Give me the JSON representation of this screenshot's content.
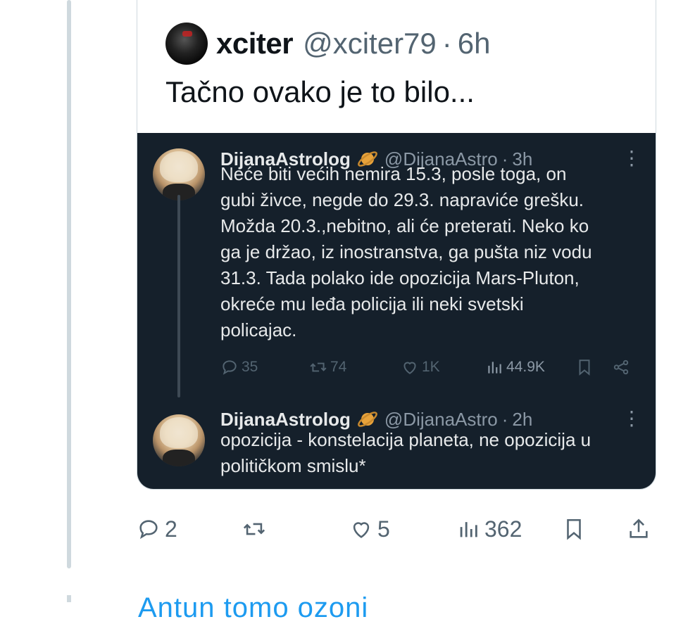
{
  "quote": {
    "author_name": "xciter",
    "author_handle": "@xciter79",
    "separator": "·",
    "time": "6h",
    "text": "Tačno ovako je to bilo..."
  },
  "embedded": {
    "tweet1": {
      "name": "DijanaAstrolog",
      "handle": "@DijanaAstro",
      "separator": "·",
      "time": "3h",
      "more": "⋮",
      "lines": [
        "Neće biti većih nemira 15.3, posle toga, on",
        "gubi živce, negde do 29.3. napraviće grešku.",
        "Možda 20.3.,nebitno, ali će preterati. Neko ko",
        "ga je držao, iz inostranstva, ga pušta niz vodu",
        "31.3. Tada polako ide opozicija Mars-Pluton,",
        "okreće mu leđa policija ili neki svetski",
        "policajac."
      ],
      "replies": "35",
      "retweets": "74",
      "likes": "1K",
      "views": "44.9K"
    },
    "tweet2": {
      "name": "DijanaAstrolog",
      "handle": "@DijanaAstro",
      "separator": "·",
      "time": "2h",
      "more": "⋮",
      "lines": [
        "opozicija - konstelacija planeta, ne opozicija u",
        "političkom smislu*"
      ]
    }
  },
  "actions": {
    "replies": "2",
    "likes": "5",
    "views": "362"
  },
  "next_tweet_partial": "Antun tomo ozoni"
}
